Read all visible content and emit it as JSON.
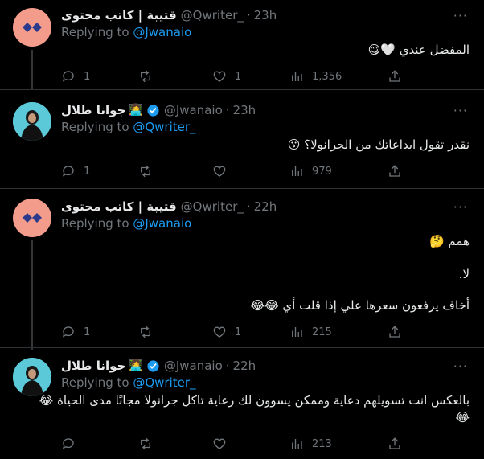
{
  "tweets": [
    {
      "name": "قتيبة | كاتب محتوى",
      "handle": "@Qwriter_",
      "time": "23h",
      "replying_prefix": "Replying to",
      "replying_to": "@Jwanaio",
      "text": "المفضل عندي 🤍😋",
      "replies": "1",
      "retweets": "",
      "likes": "1",
      "views": "1,356"
    },
    {
      "name": "جوانا طلال",
      "handle": "@Jwanaio",
      "time": "23h",
      "replying_prefix": "Replying to",
      "replying_to": "@Qwriter_",
      "text": "نقدر تقول ابداعاتك من الجرانولا؟ 😗",
      "replies": "1",
      "retweets": "",
      "likes": "",
      "views": "979"
    },
    {
      "name": "قتيبة | كاتب محتوى",
      "handle": "@Qwriter_",
      "time": "22h",
      "replying_prefix": "Replying to",
      "replying_to": "@Jwanaio",
      "lines": [
        "همم 🤔",
        "لا.",
        "أخاف يرفعون سعرها علي إذا قلت أي 😂😂"
      ],
      "replies": "1",
      "retweets": "",
      "likes": "1",
      "views": "215"
    },
    {
      "name": "جوانا طلال",
      "handle": "@Jwanaio",
      "time": "22h",
      "replying_prefix": "Replying to",
      "replying_to": "@Qwriter_",
      "lines": [
        "بالعكس انت تسويلهم دعاية وممكن يسوون لك رعاية تاكل جرانولا مجانًا مدى الحياة 😂",
        "😂"
      ],
      "replies": "",
      "retweets": "",
      "likes": "",
      "views": "213"
    }
  ],
  "icons": {
    "more": "more-dots-icon",
    "reply": "reply-icon",
    "retweet": "retweet-icon",
    "like": "heart-icon",
    "views": "views-icon",
    "share": "share-icon",
    "verified": "verified-badge-icon"
  },
  "colors": {
    "background": "#000000",
    "link": "#1d9bf0",
    "muted": "#71767b",
    "verified": "#1d9bf0"
  }
}
